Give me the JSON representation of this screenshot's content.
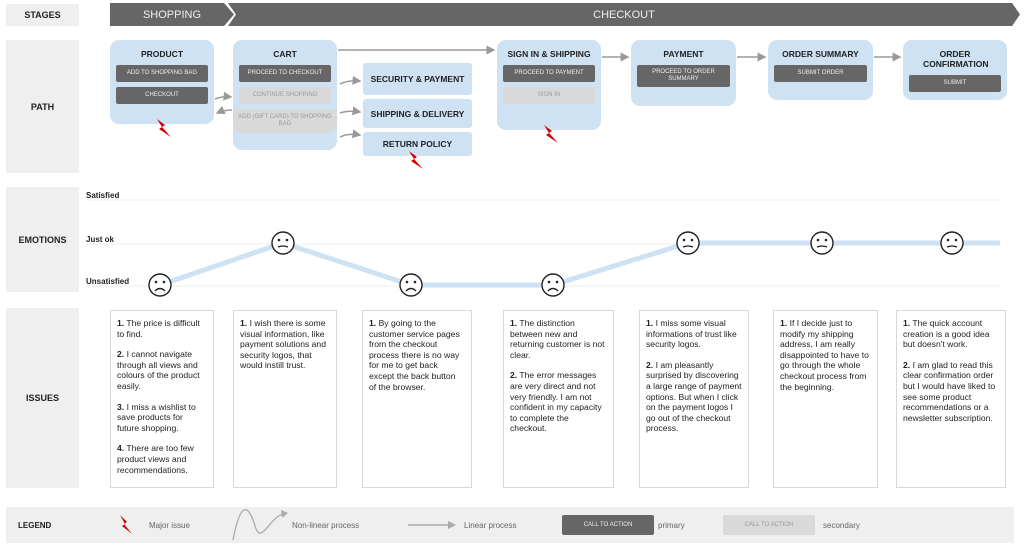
{
  "rows": {
    "stages": "STAGES",
    "path": "PATH",
    "emotions": "EMOTIONS",
    "issues": "ISSUES",
    "legend": "LEGEND"
  },
  "stages": [
    "SHOPPING",
    "CHECKOUT"
  ],
  "path": {
    "steps": [
      {
        "title": "PRODUCT",
        "ctas": [
          {
            "label": "ADD TO SHOPPING BAG",
            "type": "primary"
          },
          {
            "label": "CHECKOUT",
            "type": "primary"
          }
        ],
        "major_issue": true
      },
      {
        "title": "CART",
        "ctas": [
          {
            "label": "PROCEED TO CHECKOUT",
            "type": "primary"
          },
          {
            "label": "CONTINUE SHOPPING",
            "type": "secondary"
          },
          {
            "label": "ADD (GIFT CARD) TO SHOPPING BAG",
            "type": "secondary"
          }
        ],
        "major_issue": false
      },
      {
        "title": "SIGN IN & SHIPPING",
        "ctas": [
          {
            "label": "PROCEED TO PAYMENT",
            "type": "primary"
          },
          {
            "label": "SIGN IN",
            "type": "secondary"
          }
        ],
        "major_issue": true
      },
      {
        "title": "PAYMENT",
        "ctas": [
          {
            "label": "PROCEED TO ORDER SUMMARY",
            "type": "primary"
          }
        ],
        "major_issue": false
      },
      {
        "title": "ORDER SUMMARY",
        "ctas": [
          {
            "label": "SUBMIT ORDER",
            "type": "primary"
          }
        ],
        "major_issue": false
      },
      {
        "title": "ORDER CONFIRMATION",
        "ctas": [
          {
            "label": "SUBMIT",
            "type": "primary"
          }
        ],
        "major_issue": false
      }
    ],
    "side_pages": [
      {
        "title": "SECURITY & PAYMENT",
        "major_issue": false
      },
      {
        "title": "SHIPPING & DELIVERY",
        "major_issue": false
      },
      {
        "title": "RETURN POLICY",
        "major_issue": true
      }
    ]
  },
  "emotions": {
    "levels": [
      "Satisfied",
      "Just ok",
      "Unsatisfied"
    ],
    "points": [
      "Unsatisfied",
      "Just ok",
      "Unsatisfied",
      "Unsatisfied",
      "Just ok",
      "Just ok",
      "Just ok"
    ],
    "line_color": "#cfe2f3"
  },
  "issues": [
    [
      [
        "1.",
        "The price is difficult to find."
      ],
      [
        "2.",
        "I cannot  navigate through all views and colours of the product easily."
      ],
      [
        "3.",
        "I miss a wishlist to save products for future shopping."
      ],
      [
        "4.",
        "There are too few product views and recommendations."
      ]
    ],
    [
      [
        "1.",
        "I wish there is some visual information, like payment solutions and security logos, that would instill trust."
      ]
    ],
    [
      [
        "1.",
        "By going to the customer service pages from the checkout process there is no way for me to get back except the back button of the browser."
      ]
    ],
    [
      [
        "1.",
        "The distinction between new and returning customer is not clear."
      ],
      [
        "2.",
        "The error messages are very direct and not very  friendly. I am not confident in my capacity to complete the checkout."
      ]
    ],
    [
      [
        "1.",
        "I miss some visual informations of trust like security logos."
      ],
      [
        "2.",
        "I am pleasantly surprised by discovering a large range of payment options. But when I click on the payment logos I go out of the checkout process."
      ]
    ],
    [
      [
        "1.",
        "If I decide just to modify my shipping address, I am really disappointed to have to go through the whole checkout process from the beginning."
      ]
    ],
    [
      [
        "1.",
        "The quick account creation is a good idea but doesn't work."
      ],
      [
        "2.",
        "I am glad to read this clear confirmation order but I would have liked to see some product recommendations or a newsletter subscription."
      ]
    ]
  ],
  "legend": {
    "major_issue": "Major issue",
    "nonlinear": "Non-linear process",
    "linear": "Linear process",
    "cta_label": "CALL TO ACTION",
    "primary": "primary",
    "secondary": "secondary"
  },
  "colors": {
    "step_bg": "#cfe2f3",
    "primary_cta": "#666666",
    "secondary_cta": "#d9d9d9",
    "major_issue": "#d00000",
    "stage_bar": "#666666"
  }
}
